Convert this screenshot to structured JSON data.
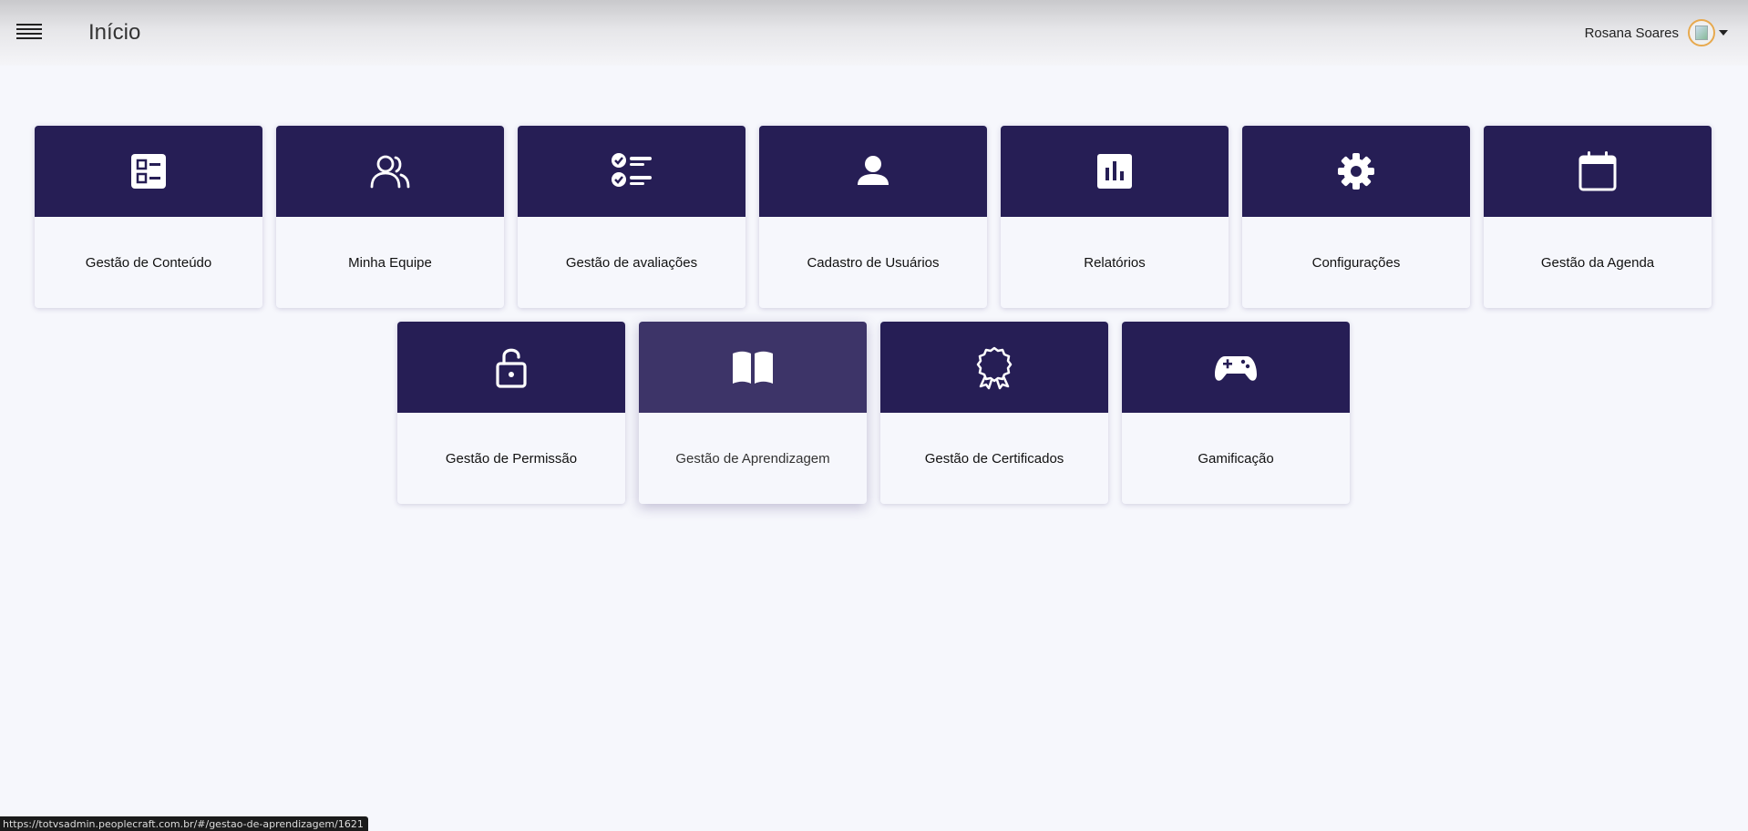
{
  "header": {
    "title": "Início",
    "user_name": "Rosana Soares",
    "menu_icon": "hamburger-icon",
    "avatar_icon": "broken-image-icon",
    "dropdown_icon": "caret-down-icon"
  },
  "cards": [
    {
      "label": "Gestão de Conteúdo",
      "icon": "content-list-icon"
    },
    {
      "label": "Minha Equipe",
      "icon": "team-icon"
    },
    {
      "label": "Gestão de avaliações",
      "icon": "checklist-icon"
    },
    {
      "label": "Cadastro de Usuários",
      "icon": "user-icon"
    },
    {
      "label": "Relatórios",
      "icon": "bar-chart-icon"
    },
    {
      "label": "Configurações",
      "icon": "gear-icon"
    },
    {
      "label": "Gestão da Agenda",
      "icon": "calendar-icon"
    },
    {
      "label": "Gestão de Permissão",
      "icon": "unlock-icon"
    },
    {
      "label": "Gestão de Aprendizagem",
      "icon": "open-book-icon"
    },
    {
      "label": "Gestão de Certificados",
      "icon": "award-icon"
    },
    {
      "label": "Gamificação",
      "icon": "gamepad-icon"
    }
  ],
  "colors": {
    "card_header": "#261e55",
    "card_header_hover": "#3d3468",
    "background": "#f6f7fc",
    "avatar_border": "#e7a94e"
  },
  "status_bar": {
    "url": "https://totvsadmin.peoplecraft.com.br/#/gestao-de-aprendizagem/1621"
  }
}
